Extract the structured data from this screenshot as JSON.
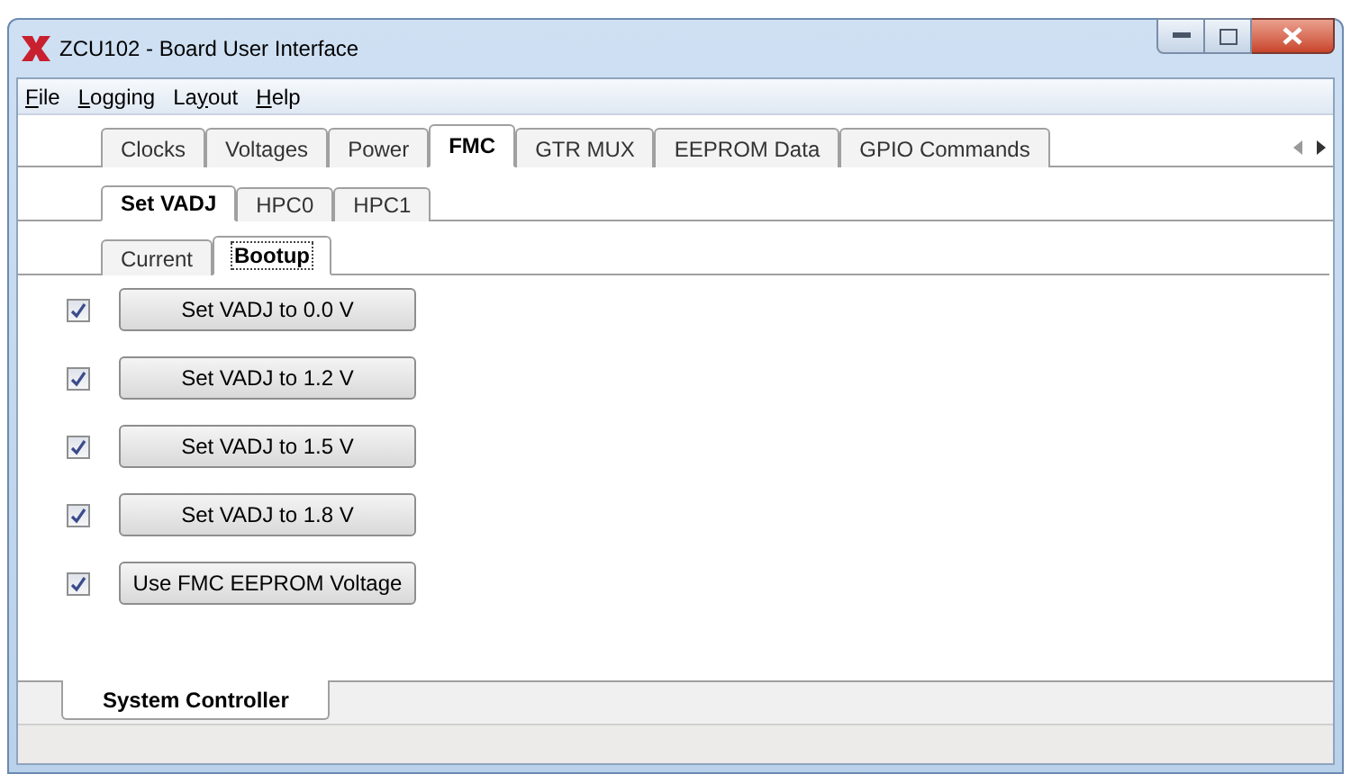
{
  "window": {
    "title": "ZCU102 - Board User Interface"
  },
  "menu": [
    {
      "key": "F",
      "post": "ile"
    },
    {
      "key": "L",
      "post": "ogging"
    },
    {
      "pre": "La",
      "key": "y",
      "post": "out"
    },
    {
      "key": "H",
      "post": "elp"
    }
  ],
  "main_tabs": [
    {
      "label": "Clocks",
      "selected": false
    },
    {
      "label": "Voltages",
      "selected": false
    },
    {
      "label": "Power",
      "selected": false
    },
    {
      "label": "FMC",
      "selected": true
    },
    {
      "label": "GTR MUX",
      "selected": false
    },
    {
      "label": "EEPROM Data",
      "selected": false
    },
    {
      "label": "GPIO Commands",
      "selected": false
    }
  ],
  "fmc_tabs": [
    {
      "label": "Set VADJ",
      "selected": true
    },
    {
      "label": "HPC0",
      "selected": false
    },
    {
      "label": "HPC1",
      "selected": false
    }
  ],
  "vadj_tabs": [
    {
      "label": "Current",
      "selected": false,
      "focused": false
    },
    {
      "label": "Bootup",
      "selected": true,
      "focused": true
    }
  ],
  "rows": [
    {
      "checked": true,
      "button": "Set VADJ to 0.0 V"
    },
    {
      "checked": true,
      "button": "Set VADJ to 1.2 V"
    },
    {
      "checked": true,
      "button": "Set VADJ to 1.5 V"
    },
    {
      "checked": true,
      "button": "Set VADJ to 1.8 V"
    },
    {
      "checked": true,
      "button": "Use FMC EEPROM Voltage"
    }
  ],
  "bottom_tabs": [
    {
      "label": "System Controller",
      "selected": true
    }
  ]
}
